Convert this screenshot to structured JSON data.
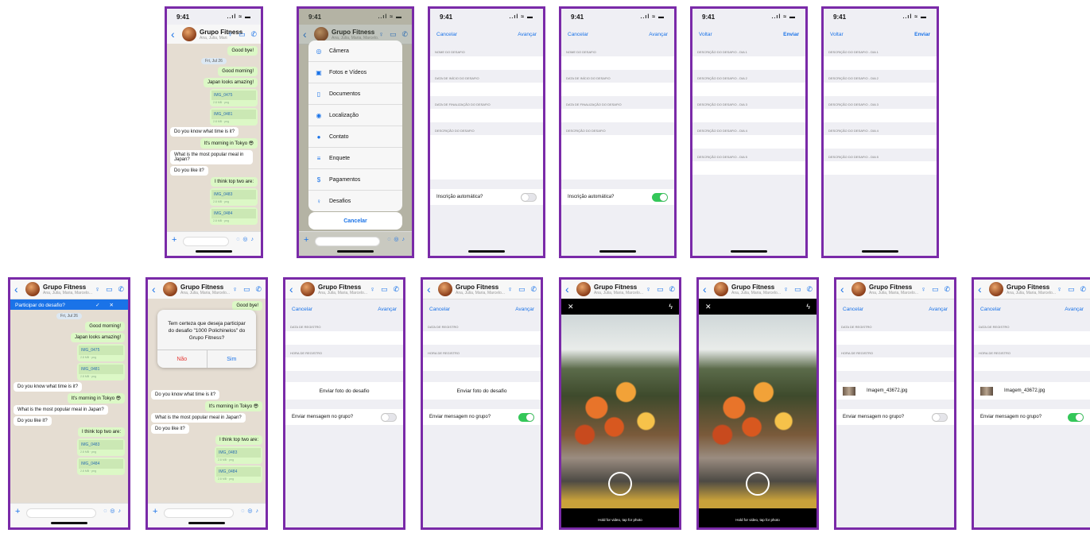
{
  "status": {
    "time": "9:41",
    "signal": "..ıl ≈ ▬"
  },
  "group": {
    "name": "Grupo Fitness",
    "members": "Ana, Julia, Maria, Marcelo..."
  },
  "icons": {
    "back": "chevron-left-icon",
    "challenge": "trophy-icon",
    "video": "video-icon",
    "call": "phone-icon",
    "plus": "plus-icon",
    "sticker": "sticker-icon",
    "camera": "camera-icon",
    "mic": "mic-icon"
  },
  "chat": {
    "goodbye": "Good bye!",
    "date": "Fri, Jul 26",
    "good_morning": "Good morning!",
    "japan": "Japan looks amazing!",
    "img1": "IMG_0475",
    "img2": "IMG_0481",
    "what_time": "Do you know what time is it?",
    "morning_tokyo": "It's morning in Tokyo 😎",
    "popular_meal": "What is the most popular meal in Japan?",
    "like_it": "Do you like it?",
    "top_two": "I think top two are:",
    "img3": "IMG_0483",
    "img4": "IMG_0484",
    "img_meta": "2.8 MB · png",
    "time": "11:40"
  },
  "attach": {
    "items": [
      "Câmera",
      "Fotos e Vídeos",
      "Documentos",
      "Localização",
      "Contato",
      "Enquete",
      "Pagamentos",
      "Desafios"
    ],
    "cancel": "Cancelar"
  },
  "form": {
    "cancel": "Cancelar",
    "next": "Avançar",
    "back": "Voltar",
    "send": "Enviar",
    "challenge_name": "NOME DO DESAFIO",
    "start_date": "DATA DE INÍCIO DO DESAFIO",
    "end_date": "DATA DE FINALIZAÇÃO DO DESAFIO",
    "description": "DESCRIÇÃO DO DESAFIO",
    "auto_signup": "Inscrição automática?",
    "day_labels": [
      "DESCRIÇÃO DO DESAFIO - DIA 1",
      "DESCRIÇÃO DO DESAFIO - DIA 2",
      "DESCRIÇÃO DO DESAFIO - DIA 3",
      "DESCRIÇÃO DO DESAFIO - DIA 4",
      "DESCRIÇÃO DO DESAFIO - DIA 5"
    ]
  },
  "participate": {
    "bar_label": "Participar do desafio?",
    "alert_text": "Tem certeza que deseja participar do desafio \"1000 Polichinelos\" do Grupo Fitness?",
    "no": "Não",
    "yes": "Sim"
  },
  "register": {
    "date": "DATA DE REGISTRO",
    "hour": "HORA DE REGISTRO",
    "send_photo": "Enviar foto do desafio",
    "send_msg": "Enviar mensagem no grupo?",
    "image_name": "Imagem_43672.jpg"
  },
  "camera": {
    "hint": "Hold for video, tap for photo"
  },
  "colors": {
    "frame": "#7a2aa8",
    "accent": "#1a73e8",
    "toggle_on": "#34c759",
    "chat_bg": "#e5ddd2",
    "bubble_out": "#dcf8c6"
  }
}
